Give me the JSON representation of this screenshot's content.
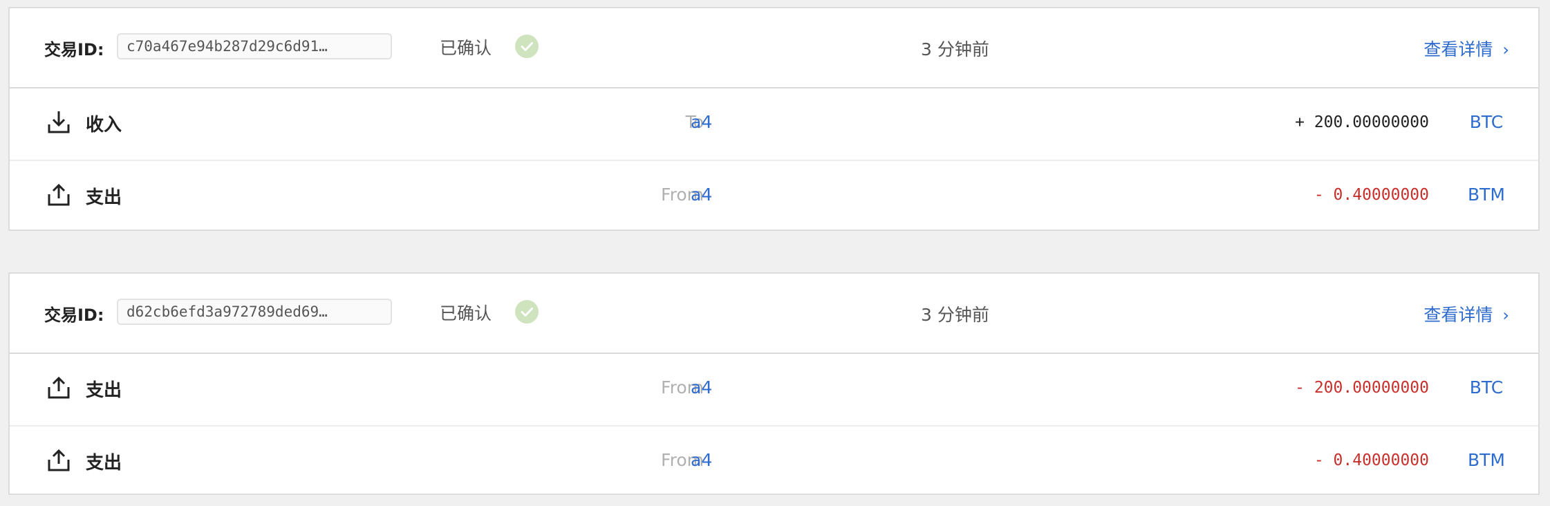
{
  "transactions": [
    {
      "id_label": "交易ID:",
      "id_value": "c70a467e94b287d29c6d91…",
      "status": "已确认",
      "time": "3 分钟前",
      "detail_label": "查看详情",
      "entries": [
        {
          "type": "收入",
          "direction": "To",
          "account": "a4",
          "amount": "+ 200.00000000",
          "asset": "BTC",
          "kind": "in"
        },
        {
          "type": "支出",
          "direction": "From",
          "account": "a4",
          "amount": "- 0.40000000",
          "asset": "BTM",
          "kind": "out"
        }
      ]
    },
    {
      "id_label": "交易ID:",
      "id_value": "d62cb6efd3a972789ded69…",
      "status": "已确认",
      "time": "3 分钟前",
      "detail_label": "查看详情",
      "entries": [
        {
          "type": "支出",
          "direction": "From",
          "account": "a4",
          "amount": "- 200.00000000",
          "asset": "BTC",
          "kind": "out"
        },
        {
          "type": "支出",
          "direction": "From",
          "account": "a4",
          "amount": "- 0.40000000",
          "asset": "BTM",
          "kind": "out"
        }
      ]
    }
  ],
  "icons": {
    "confirmed": "check-circle-icon",
    "detail": "chevron-right-icon",
    "in": "download-icon",
    "out": "upload-icon"
  },
  "colors": {
    "link": "#2d6cce",
    "negative": "#c8302c",
    "confirmed_badge": "#cfe3be",
    "background": "#f0f0f0"
  }
}
